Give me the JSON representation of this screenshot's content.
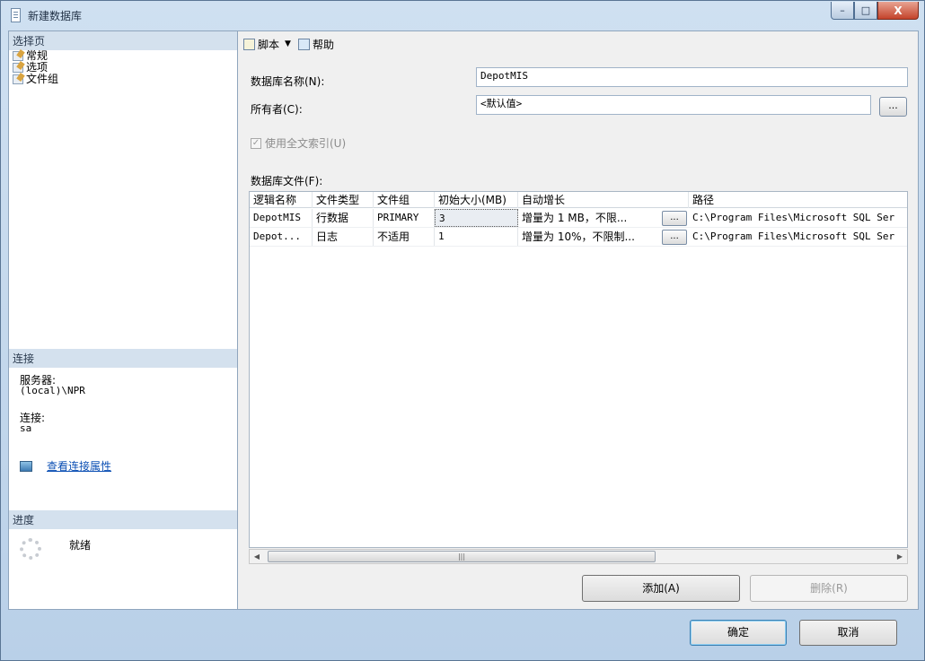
{
  "window": {
    "title": "新建数据库",
    "controls": {
      "minimize": "–",
      "maximize": "□",
      "close": "X"
    }
  },
  "left_panel": {
    "select_page_header": "选择页",
    "pages": [
      {
        "label": "常规",
        "icon": "page-settings-icon"
      },
      {
        "label": "选项",
        "icon": "page-settings-icon"
      },
      {
        "label": "文件组",
        "icon": "page-settings-icon"
      }
    ],
    "connection_header": "连接",
    "server_label": "服务器:",
    "server_value": "(local)\\NPR",
    "connection_label": "连接:",
    "connection_value": "sa",
    "view_props_link": "查看连接属性",
    "progress_header": "进度",
    "progress_status": "就绪"
  },
  "toolbar": {
    "script_label": "脚本",
    "help_label": "帮助"
  },
  "form": {
    "db_name_label": "数据库名称(N):",
    "db_name_value": "DepotMIS",
    "owner_label": "所有者(C):",
    "owner_value": "<默认值>",
    "ellipsis": "...",
    "fulltext_label": "使用全文索引(U)",
    "fulltext_check": "✓",
    "db_files_label": "数据库文件(F):"
  },
  "files_grid": {
    "columns": [
      "逻辑名称",
      "文件类型",
      "文件组",
      "初始大小(MB)",
      "自动增长",
      "路径"
    ],
    "rows": [
      [
        "DepotMIS",
        "行数据",
        "PRIMARY",
        "3",
        "增量为 1 MB，不限...",
        "C:\\Program Files\\Microsoft SQL Ser"
      ],
      [
        "Depot...",
        "日志",
        "不适用",
        "1",
        "增量为 10%，不限制...",
        "C:\\Program Files\\Microsoft SQL Ser"
      ]
    ],
    "grow_button": "..."
  },
  "scrollbar": {
    "left_arrow": "◀",
    "right_arrow": "▶",
    "grip": "|||"
  },
  "buttons": {
    "add": "添加(A)",
    "remove": "删除(R)",
    "ok": "确定",
    "cancel": "取消"
  }
}
